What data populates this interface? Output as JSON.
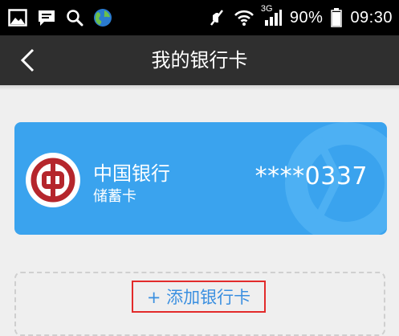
{
  "status_bar": {
    "icons_left": [
      "image-icon",
      "message-icon",
      "search-icon",
      "globe-icon"
    ],
    "icons_right": [
      "mute-icon",
      "wifi-icon",
      "signal-icon",
      "battery-icon"
    ],
    "network_label": "3G",
    "battery": "90%",
    "time": "09:30"
  },
  "nav": {
    "title": "我的银行卡",
    "back_icon": "chevron-left-icon"
  },
  "card": {
    "bank_name": "中国银行",
    "card_type": "储蓄卡",
    "card_number": "****0337",
    "logo_icon": "bank-of-china-logo",
    "color": "#3aa3ee"
  },
  "add_card": {
    "label": "+ 添加银行卡",
    "text_color": "#3a8fe0",
    "highlight_color": "#e22b2b"
  }
}
